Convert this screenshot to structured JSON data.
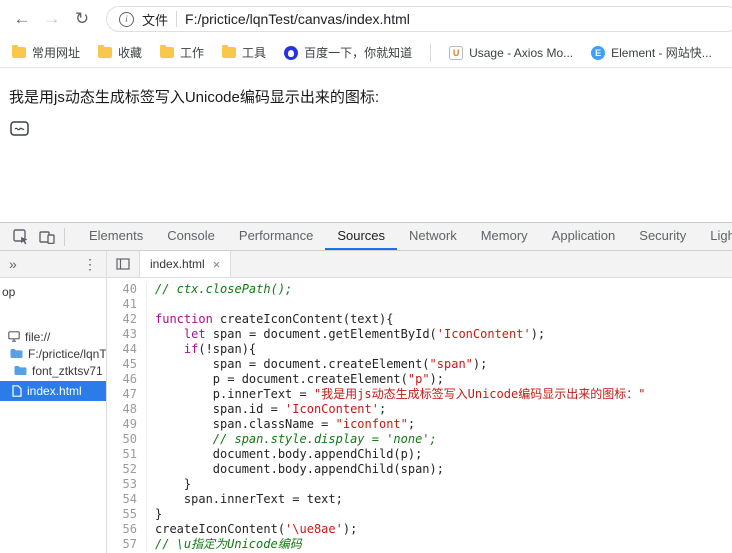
{
  "icons": {
    "back": "←",
    "forward": "→",
    "refresh": "↻",
    "info": "i",
    "chevrons": "»",
    "dots": "⋮",
    "close": "×"
  },
  "browser": {
    "scheme_label": "文件",
    "url": "F:/prictice/lqnTest/canvas/index.html"
  },
  "bookmarks": {
    "items": [
      {
        "id": "changyongwangzhi",
        "label": "常用网址",
        "icon": "folder"
      },
      {
        "id": "shoucang",
        "label": "收藏",
        "icon": "folder"
      },
      {
        "id": "gongzuo",
        "label": "工作",
        "icon": "folder"
      },
      {
        "id": "gongju",
        "label": "工具",
        "icon": "folder"
      },
      {
        "id": "baidu",
        "label": "百度一下，你就知道",
        "icon": "baidu"
      },
      {
        "type": "divider"
      },
      {
        "id": "usage-axios",
        "label": "Usage - Axios Mo...",
        "icon": "usage",
        "icon_text": "U"
      },
      {
        "id": "element",
        "label": "Element - 网站快...",
        "icon": "element",
        "icon_text": "E"
      }
    ]
  },
  "page": {
    "text": "我是用js动态生成标签写入Unicode编码显示出来的图标:",
    "icon_name": "iconfont-ue8ae"
  },
  "devtools": {
    "tabs": [
      "Elements",
      "Console",
      "Performance",
      "Sources",
      "Network",
      "Memory",
      "Application",
      "Security",
      "Lighthouse"
    ],
    "active_tab": "Sources",
    "file_tab": "index.html",
    "navigator": {
      "items": [
        {
          "label": "op",
          "icon": "none",
          "cls": "root"
        },
        {
          "label": "file://",
          "icon": "monitor",
          "cls": "lvl1"
        },
        {
          "label": "F:/prictice/lqnT",
          "icon": "folder",
          "cls": "lvl2"
        },
        {
          "label": "font_ztktsv71",
          "icon": "folder",
          "cls": "lvl3"
        },
        {
          "label": "index.html",
          "icon": "file",
          "cls": "selected"
        }
      ]
    },
    "editor": {
      "lines": [
        {
          "no": 40,
          "tk": [
            {
              "t": "c",
              "v": "// ctx.closePath();"
            }
          ]
        },
        {
          "no": 41,
          "tk": []
        },
        {
          "no": 42,
          "tk": [
            {
              "t": "k",
              "v": "function"
            },
            {
              "t": "p",
              "v": " createIconContent(text){"
            }
          ]
        },
        {
          "no": 43,
          "tk": [
            {
              "t": "p",
              "v": "    "
            },
            {
              "t": "k",
              "v": "let"
            },
            {
              "t": "p",
              "v": " span = document.getElementById("
            },
            {
              "t": "s",
              "v": "'IconContent'"
            },
            {
              "t": "p",
              "v": ");"
            }
          ]
        },
        {
          "no": 44,
          "tk": [
            {
              "t": "p",
              "v": "    "
            },
            {
              "t": "k",
              "v": "if"
            },
            {
              "t": "p",
              "v": "(!span){"
            }
          ]
        },
        {
          "no": 45,
          "tk": [
            {
              "t": "p",
              "v": "        span = document.createElement("
            },
            {
              "t": "s",
              "v": "\"span\""
            },
            {
              "t": "p",
              "v": ");"
            }
          ]
        },
        {
          "no": 46,
          "tk": [
            {
              "t": "p",
              "v": "        p = document.createElement("
            },
            {
              "t": "s",
              "v": "\"p\""
            },
            {
              "t": "p",
              "v": ");"
            }
          ]
        },
        {
          "no": 47,
          "tk": [
            {
              "t": "p",
              "v": "        p.innerText = "
            },
            {
              "t": "s",
              "v": "\"我是用js动态生成标签写入Unicode编码显示出来的图标：\""
            }
          ]
        },
        {
          "no": 48,
          "tk": [
            {
              "t": "p",
              "v": "        span.id = "
            },
            {
              "t": "s",
              "v": "'IconContent'"
            },
            {
              "t": "p",
              "v": ";"
            }
          ]
        },
        {
          "no": 49,
          "tk": [
            {
              "t": "p",
              "v": "        span.className = "
            },
            {
              "t": "s",
              "v": "\"iconfont\""
            },
            {
              "t": "p",
              "v": ";"
            }
          ]
        },
        {
          "no": 50,
          "tk": [
            {
              "t": "c",
              "v": "        // span.style.display = 'none';"
            }
          ]
        },
        {
          "no": 51,
          "tk": [
            {
              "t": "p",
              "v": "        document.body.appendChild(p);"
            }
          ]
        },
        {
          "no": 52,
          "tk": [
            {
              "t": "p",
              "v": "        document.body.appendChild(span);"
            }
          ]
        },
        {
          "no": 53,
          "tk": [
            {
              "t": "p",
              "v": "    }"
            }
          ]
        },
        {
          "no": 54,
          "tk": [
            {
              "t": "p",
              "v": "    span.innerText = text;"
            }
          ]
        },
        {
          "no": 55,
          "tk": [
            {
              "t": "p",
              "v": "}"
            }
          ]
        },
        {
          "no": 56,
          "tk": [
            {
              "t": "p",
              "v": "createIconContent("
            },
            {
              "t": "s",
              "v": "'\\ue8ae'"
            },
            {
              "t": "p",
              "v": ");"
            }
          ]
        },
        {
          "no": 57,
          "tk": [
            {
              "t": "c",
              "v": "// \\u指定为Unicode编码"
            }
          ]
        }
      ]
    }
  }
}
